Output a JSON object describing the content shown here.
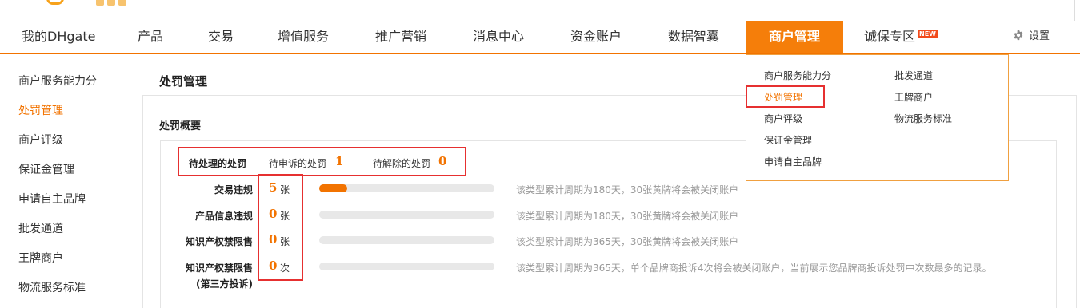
{
  "nav": {
    "items": [
      {
        "label": "我的DHgate"
      },
      {
        "label": "产品"
      },
      {
        "label": "交易"
      },
      {
        "label": "增值服务"
      },
      {
        "label": "推广营销"
      },
      {
        "label": "消息中心"
      },
      {
        "label": "资金账户"
      },
      {
        "label": "数据智囊"
      },
      {
        "label": "商户管理",
        "active": true
      },
      {
        "label": "诚保专区",
        "badge": "NEW"
      }
    ],
    "settings_label": "设置"
  },
  "sidebar": {
    "items": [
      {
        "label": "商户服务能力分"
      },
      {
        "label": "处罚管理",
        "active": true
      },
      {
        "label": "商户评级"
      },
      {
        "label": "保证金管理"
      },
      {
        "label": "申请自主品牌"
      },
      {
        "label": "批发通道"
      },
      {
        "label": "王牌商户"
      },
      {
        "label": "物流服务标准"
      }
    ]
  },
  "main": {
    "page_title": "处罚管理",
    "section_title": "处罚概要",
    "summary": {
      "pending_label": "待处理的处罚",
      "appeal_label": "待申诉的处罚",
      "appeal_count": "1",
      "release_label": "待解除的处罚",
      "release_count": "0"
    },
    "rows": [
      {
        "label": "交易违规",
        "count": "5",
        "unit": "张",
        "fill": 0.16,
        "desc": "该类型累计周期为180天，30张黄牌将会被关闭账户"
      },
      {
        "label": "产品信息违规",
        "count": "0",
        "unit": "张",
        "fill": 0,
        "desc": "该类型累计周期为180天，30张黄牌将会被关闭账户"
      },
      {
        "label": "知识产权禁限售",
        "count": "0",
        "unit": "张",
        "fill": 0,
        "desc": "该类型累计周期为365天，30张黄牌将会被关闭账户"
      },
      {
        "label": "知识产权禁限售",
        "label2": "(第三方投诉)",
        "count": "0",
        "unit": "次",
        "fill": 0,
        "desc": "该类型累计周期为365天，单个品牌商投诉4次将会被关闭账户，当前展示您品牌商投诉处罚中次数最多的记录。"
      }
    ]
  },
  "dropdown": {
    "col1": [
      "商户服务能力分",
      "处罚管理",
      "商户评级",
      "保证金管理",
      "申请自主品牌"
    ],
    "col2": [
      "批发通道",
      "王牌商户",
      "物流服务标准"
    ]
  },
  "colors": {
    "accent": "#f27300",
    "nav_active": "#f57e0a",
    "highlight_border": "#e63030"
  }
}
